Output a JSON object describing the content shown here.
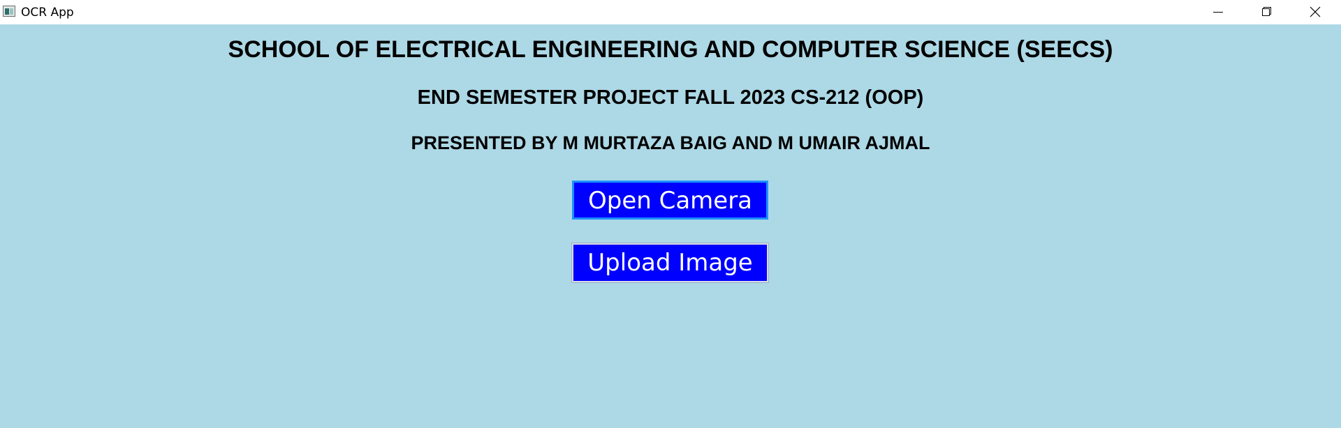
{
  "window": {
    "title": "OCR App",
    "icon": "app-window-icon",
    "controls": {
      "minimize_icon": "minimize-icon",
      "maximize_icon": "restore-icon",
      "close_icon": "close-icon"
    }
  },
  "main": {
    "heading1": "SCHOOL OF ELECTRICAL ENGINEERING AND COMPUTER SCIENCE (SEECS)",
    "heading2": "END SEMESTER PROJECT FALL 2023 CS-212 (OOP)",
    "heading3": "PRESENTED BY M MURTAZA BAIG AND M UMAIR AJMAL",
    "buttons": {
      "open_camera": "Open Camera",
      "upload_image": "Upload Image"
    }
  },
  "colors": {
    "background": "#add8e6",
    "button_bg": "#0000ff",
    "button_text": "#ffffff",
    "focus_border": "#1e90ff"
  }
}
